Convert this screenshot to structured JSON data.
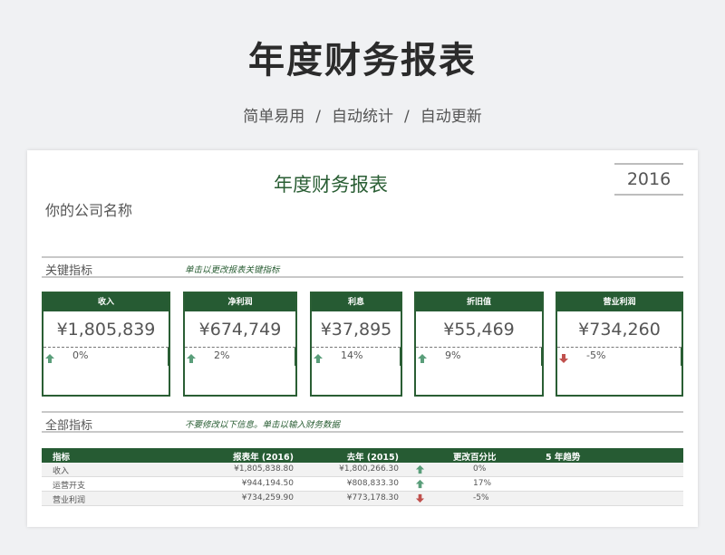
{
  "hero": {
    "title": "年度财务报表",
    "subtitle_parts": [
      "简单易用",
      "自动统计",
      "自动更新"
    ],
    "separator": "/"
  },
  "sheet": {
    "title": "年度财务报表",
    "year": "2016",
    "company": "你的公司名称"
  },
  "key_section": {
    "label": "关键指标",
    "hint": "单击以更改报表关键指标"
  },
  "cards": [
    {
      "name": "收入",
      "value": "¥1,805,839",
      "change": "0%",
      "direction": "up"
    },
    {
      "name": "净利润",
      "value": "¥674,749",
      "change": "2%",
      "direction": "up"
    },
    {
      "name": "利息",
      "value": "¥37,895",
      "change": "14%",
      "direction": "up"
    },
    {
      "name": "折旧值",
      "value": "¥55,469",
      "change": "9%",
      "direction": "up"
    },
    {
      "name": "营业利润",
      "value": "¥734,260",
      "change": "-5%",
      "direction": "down"
    }
  ],
  "all_section": {
    "label": "全部指标",
    "hint": "不要修改以下信息。单击以输入财务数据"
  },
  "table": {
    "headers": [
      "指标",
      "报表年 (2016)",
      "去年 (2015)",
      "更改百分比",
      "5 年趋势"
    ],
    "rows": [
      {
        "name": "收入",
        "current": "¥1,805,838.80",
        "previous": "¥1,800,266.30",
        "direction": "up",
        "change": "0%"
      },
      {
        "name": "运营开支",
        "current": "¥944,194.50",
        "previous": "¥808,833.30",
        "direction": "up",
        "change": "17%"
      },
      {
        "name": "营业利润",
        "current": "¥734,259.90",
        "previous": "¥773,178.30",
        "direction": "down",
        "change": "-5%"
      }
    ]
  },
  "colors": {
    "accent_green": "#265b33",
    "arrow_up": "#5a9e7a",
    "arrow_down": "#c0504d"
  }
}
